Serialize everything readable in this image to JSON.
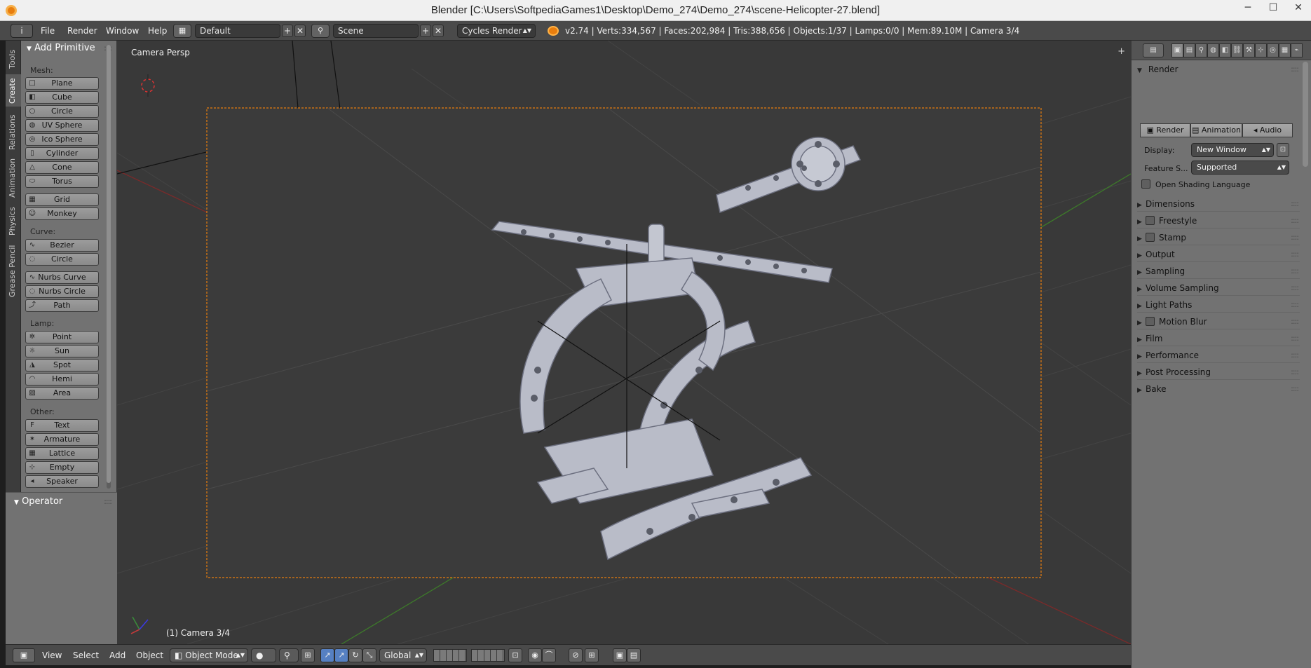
{
  "window": {
    "title": "Blender [C:\\Users\\SoftpediaGames1\\Desktop\\Demo_274\\Demo_274\\scene-Helicopter-27.blend]",
    "minimize": "─",
    "maximize": "☐",
    "close": "✕"
  },
  "header": {
    "info_icon": "i",
    "menus": [
      "File",
      "Render",
      "Window",
      "Help"
    ],
    "screen_layout": "Default",
    "scene": "Scene",
    "render_engine": "Cycles Render",
    "stats": "v2.74 | Verts:334,567 | Faces:202,984 | Tris:388,656 | Objects:1/37 | Lamps:0/0 | Mem:89.10M | Camera 3/4",
    "add_symbol": "+",
    "remove_symbol": "✕"
  },
  "toolshelf": {
    "tabs": [
      "Tools",
      "Create",
      "Relations",
      "Animation",
      "Physics",
      "Grease Pencil"
    ],
    "panel_title": "Add Primitive",
    "mesh_label": "Mesh:",
    "mesh": [
      "Plane",
      "Cube",
      "Circle",
      "UV Sphere",
      "Ico Sphere",
      "Cylinder",
      "Cone",
      "Torus",
      "Grid",
      "Monkey"
    ],
    "curve_label": "Curve:",
    "curve": [
      "Bezier",
      "Circle",
      "Nurbs Curve",
      "Nurbs Circle",
      "Path"
    ],
    "lamp_label": "Lamp:",
    "lamp": [
      "Point",
      "Sun",
      "Spot",
      "Hemi",
      "Area"
    ],
    "other_label": "Other:",
    "other": [
      "Text",
      "Armature",
      "Lattice",
      "Empty",
      "Speaker"
    ],
    "operator_title": "Operator"
  },
  "viewport": {
    "view_label": "Camera Persp",
    "camera_label": "(1) Camera 3/4",
    "corner": "+"
  },
  "properties": {
    "render_title": "Render",
    "render_buttons": [
      "Render",
      "Animation",
      "Audio"
    ],
    "display_label": "Display:",
    "display_value": "New Window",
    "feature_label": "Feature S...",
    "feature_value": "Supported",
    "osl_label": "Open Shading Language",
    "sections": [
      "Dimensions",
      "Freestyle",
      "Stamp",
      "Output",
      "Sampling",
      "Volume Sampling",
      "Light Paths",
      "Motion Blur",
      "Film",
      "Performance",
      "Post Processing",
      "Bake"
    ]
  },
  "bottombar": {
    "menus": [
      "View",
      "Select",
      "Add",
      "Object"
    ],
    "mode": "Object Mode",
    "orientation": "Global"
  },
  "colors": {
    "accent": "#e87d0d",
    "camera_frame": "#e87d0d",
    "x_axis": "#7a2a2a",
    "y_axis": "#3d7a2a",
    "active_blue": "#5680c2"
  }
}
